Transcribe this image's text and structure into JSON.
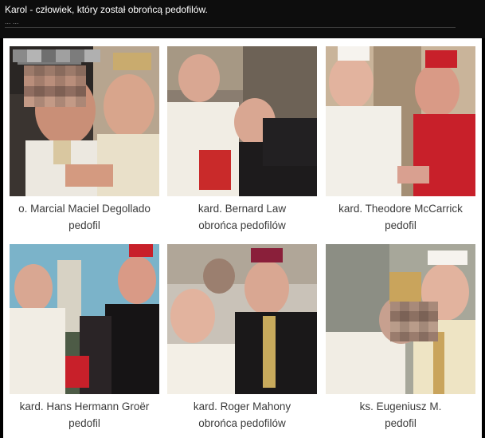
{
  "post": {
    "title": "Karol - człowiek, który został obrońcą pedofilów.",
    "subtitle": "... ..."
  },
  "tiles": [
    {
      "line1": "o. Marcial Maciel Degollado",
      "line2": "pedofil"
    },
    {
      "line1": "kard. Bernard Law",
      "line2": "obrońca pedofilów"
    },
    {
      "line1": "kard. Theodore McCarrick",
      "line2": "pedofil"
    },
    {
      "line1": "kard. Hans Hermann Groër",
      "line2": "pedofil"
    },
    {
      "line1": "kard. Roger Mahony",
      "line2": "obrońca pedofilów"
    },
    {
      "line1": "ks. Eugeniusz M.",
      "line2": "pedofil"
    }
  ],
  "colors": {
    "background": "#000000",
    "card": "#ffffff",
    "caption": "#3b3b3b",
    "cardinal_red": "#c8202a",
    "papal_white": "#f3efe6"
  }
}
